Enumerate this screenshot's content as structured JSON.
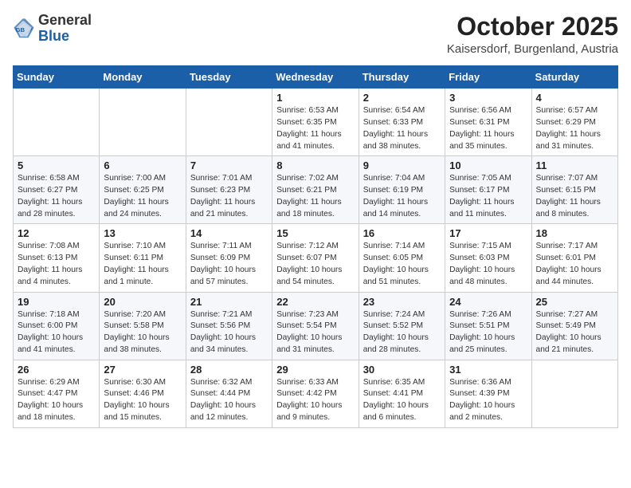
{
  "logo": {
    "general": "General",
    "blue": "Blue"
  },
  "header": {
    "month": "October 2025",
    "location": "Kaisersdorf, Burgenland, Austria"
  },
  "weekdays": [
    "Sunday",
    "Monday",
    "Tuesday",
    "Wednesday",
    "Thursday",
    "Friday",
    "Saturday"
  ],
  "weeks": [
    [
      {
        "day": "",
        "info": ""
      },
      {
        "day": "",
        "info": ""
      },
      {
        "day": "",
        "info": ""
      },
      {
        "day": "1",
        "info": "Sunrise: 6:53 AM\nSunset: 6:35 PM\nDaylight: 11 hours\nand 41 minutes."
      },
      {
        "day": "2",
        "info": "Sunrise: 6:54 AM\nSunset: 6:33 PM\nDaylight: 11 hours\nand 38 minutes."
      },
      {
        "day": "3",
        "info": "Sunrise: 6:56 AM\nSunset: 6:31 PM\nDaylight: 11 hours\nand 35 minutes."
      },
      {
        "day": "4",
        "info": "Sunrise: 6:57 AM\nSunset: 6:29 PM\nDaylight: 11 hours\nand 31 minutes."
      }
    ],
    [
      {
        "day": "5",
        "info": "Sunrise: 6:58 AM\nSunset: 6:27 PM\nDaylight: 11 hours\nand 28 minutes."
      },
      {
        "day": "6",
        "info": "Sunrise: 7:00 AM\nSunset: 6:25 PM\nDaylight: 11 hours\nand 24 minutes."
      },
      {
        "day": "7",
        "info": "Sunrise: 7:01 AM\nSunset: 6:23 PM\nDaylight: 11 hours\nand 21 minutes."
      },
      {
        "day": "8",
        "info": "Sunrise: 7:02 AM\nSunset: 6:21 PM\nDaylight: 11 hours\nand 18 minutes."
      },
      {
        "day": "9",
        "info": "Sunrise: 7:04 AM\nSunset: 6:19 PM\nDaylight: 11 hours\nand 14 minutes."
      },
      {
        "day": "10",
        "info": "Sunrise: 7:05 AM\nSunset: 6:17 PM\nDaylight: 11 hours\nand 11 minutes."
      },
      {
        "day": "11",
        "info": "Sunrise: 7:07 AM\nSunset: 6:15 PM\nDaylight: 11 hours\nand 8 minutes."
      }
    ],
    [
      {
        "day": "12",
        "info": "Sunrise: 7:08 AM\nSunset: 6:13 PM\nDaylight: 11 hours\nand 4 minutes."
      },
      {
        "day": "13",
        "info": "Sunrise: 7:10 AM\nSunset: 6:11 PM\nDaylight: 11 hours\nand 1 minute."
      },
      {
        "day": "14",
        "info": "Sunrise: 7:11 AM\nSunset: 6:09 PM\nDaylight: 10 hours\nand 57 minutes."
      },
      {
        "day": "15",
        "info": "Sunrise: 7:12 AM\nSunset: 6:07 PM\nDaylight: 10 hours\nand 54 minutes."
      },
      {
        "day": "16",
        "info": "Sunrise: 7:14 AM\nSunset: 6:05 PM\nDaylight: 10 hours\nand 51 minutes."
      },
      {
        "day": "17",
        "info": "Sunrise: 7:15 AM\nSunset: 6:03 PM\nDaylight: 10 hours\nand 48 minutes."
      },
      {
        "day": "18",
        "info": "Sunrise: 7:17 AM\nSunset: 6:01 PM\nDaylight: 10 hours\nand 44 minutes."
      }
    ],
    [
      {
        "day": "19",
        "info": "Sunrise: 7:18 AM\nSunset: 6:00 PM\nDaylight: 10 hours\nand 41 minutes."
      },
      {
        "day": "20",
        "info": "Sunrise: 7:20 AM\nSunset: 5:58 PM\nDaylight: 10 hours\nand 38 minutes."
      },
      {
        "day": "21",
        "info": "Sunrise: 7:21 AM\nSunset: 5:56 PM\nDaylight: 10 hours\nand 34 minutes."
      },
      {
        "day": "22",
        "info": "Sunrise: 7:23 AM\nSunset: 5:54 PM\nDaylight: 10 hours\nand 31 minutes."
      },
      {
        "day": "23",
        "info": "Sunrise: 7:24 AM\nSunset: 5:52 PM\nDaylight: 10 hours\nand 28 minutes."
      },
      {
        "day": "24",
        "info": "Sunrise: 7:26 AM\nSunset: 5:51 PM\nDaylight: 10 hours\nand 25 minutes."
      },
      {
        "day": "25",
        "info": "Sunrise: 7:27 AM\nSunset: 5:49 PM\nDaylight: 10 hours\nand 21 minutes."
      }
    ],
    [
      {
        "day": "26",
        "info": "Sunrise: 6:29 AM\nSunset: 4:47 PM\nDaylight: 10 hours\nand 18 minutes."
      },
      {
        "day": "27",
        "info": "Sunrise: 6:30 AM\nSunset: 4:46 PM\nDaylight: 10 hours\nand 15 minutes."
      },
      {
        "day": "28",
        "info": "Sunrise: 6:32 AM\nSunset: 4:44 PM\nDaylight: 10 hours\nand 12 minutes."
      },
      {
        "day": "29",
        "info": "Sunrise: 6:33 AM\nSunset: 4:42 PM\nDaylight: 10 hours\nand 9 minutes."
      },
      {
        "day": "30",
        "info": "Sunrise: 6:35 AM\nSunset: 4:41 PM\nDaylight: 10 hours\nand 6 minutes."
      },
      {
        "day": "31",
        "info": "Sunrise: 6:36 AM\nSunset: 4:39 PM\nDaylight: 10 hours\nand 2 minutes."
      },
      {
        "day": "",
        "info": ""
      }
    ]
  ]
}
